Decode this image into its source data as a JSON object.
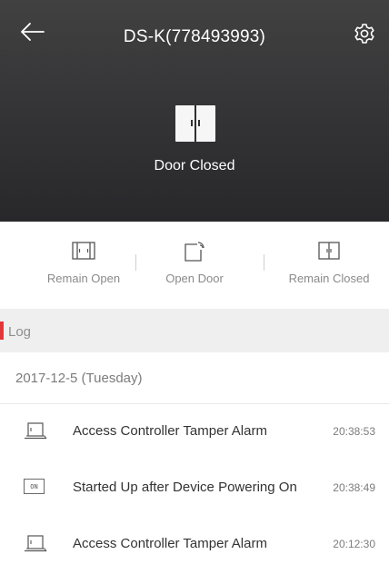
{
  "header": {
    "title": "DS-K(778493993)",
    "back_icon": "arrow-left-icon",
    "settings_icon": "gear-icon",
    "door_icon": "door-closed-icon",
    "door_status": "Door Closed",
    "background": "#333336"
  },
  "controls": [
    {
      "label": "Remain Open",
      "icon": "door-remain-open-icon"
    },
    {
      "label": "Open Door",
      "icon": "door-open-icon"
    },
    {
      "label": "Remain Closed",
      "icon": "door-remain-closed-icon"
    }
  ],
  "log": {
    "title": "Log",
    "accent": "#e2373a",
    "date": "2017-12-5 (Tuesday)",
    "entries": [
      {
        "event": "Access Controller Tamper Alarm",
        "time": "20:38:53",
        "icon": "laptop-icon"
      },
      {
        "event": "Started Up after Device Powering On",
        "time": "20:38:49",
        "icon": "power-on-icon",
        "badge": "ON"
      },
      {
        "event": "Access Controller Tamper Alarm",
        "time": "20:12:30",
        "icon": "laptop-icon"
      }
    ]
  }
}
